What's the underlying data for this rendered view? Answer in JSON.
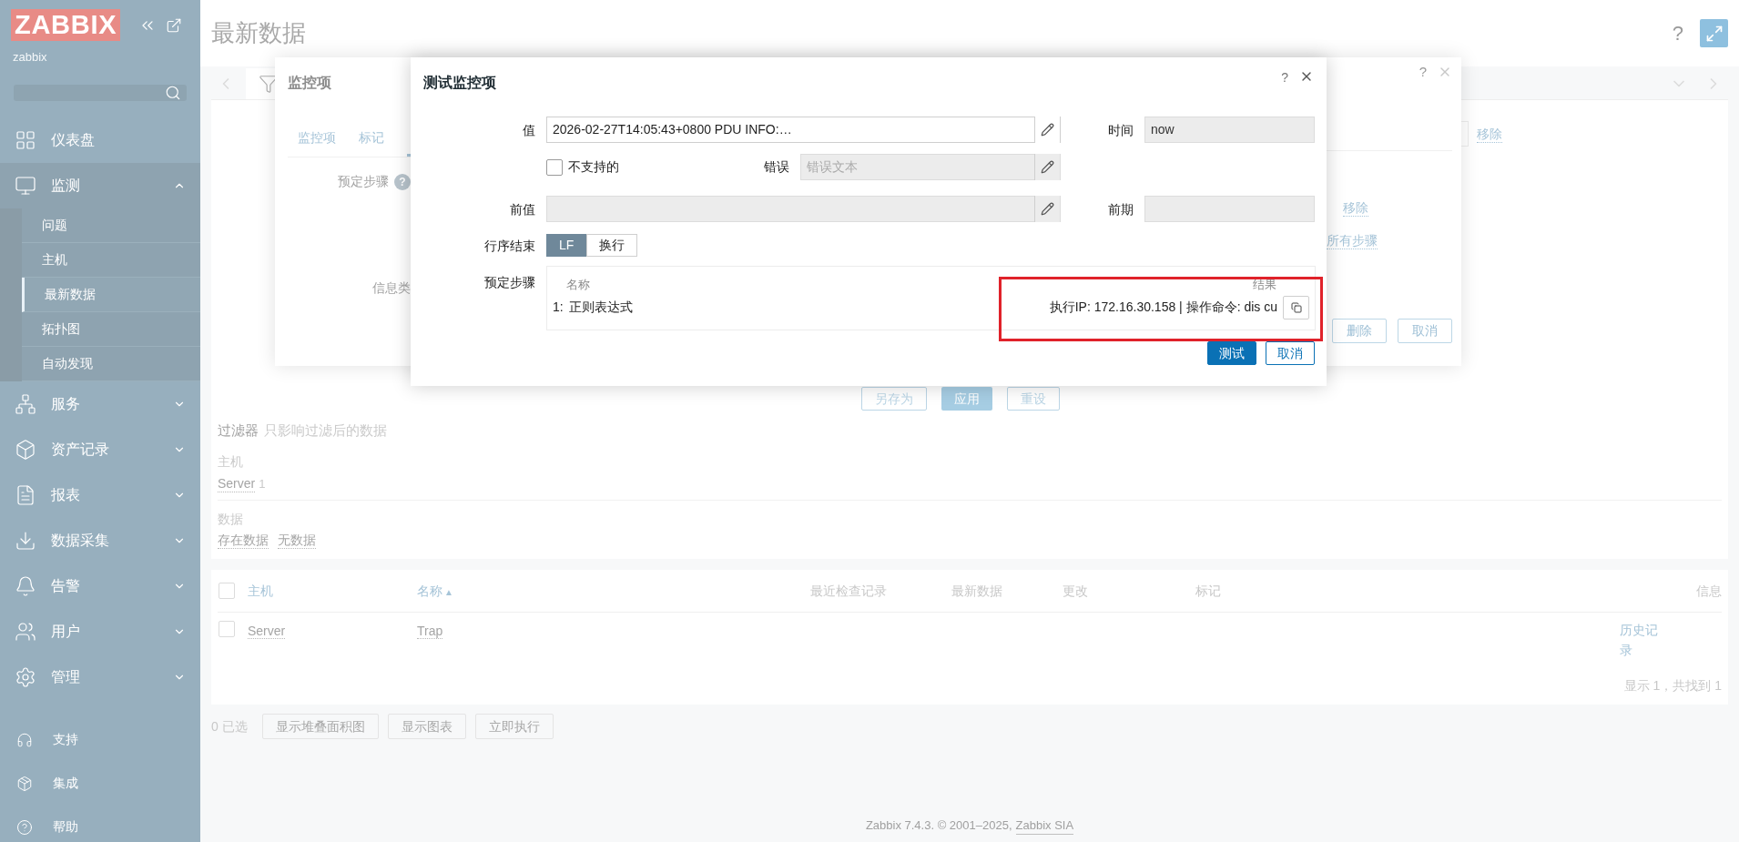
{
  "sidebar": {
    "logo": "ZABBIX",
    "user": "zabbix",
    "menu": [
      {
        "label": "仪表盘",
        "kind": "link"
      },
      {
        "label": "监测",
        "kind": "group",
        "expanded": true,
        "children": [
          {
            "label": "问题",
            "selected": false
          },
          {
            "label": "主机",
            "selected": false
          },
          {
            "label": "最新数据",
            "selected": true
          },
          {
            "label": "拓扑图",
            "selected": false
          },
          {
            "label": "自动发现",
            "selected": false
          }
        ]
      },
      {
        "label": "服务",
        "kind": "group",
        "expanded": false
      },
      {
        "label": "资产记录",
        "kind": "group",
        "expanded": false
      },
      {
        "label": "报表",
        "kind": "group",
        "expanded": false
      },
      {
        "label": "数据采集",
        "kind": "group",
        "expanded": false
      },
      {
        "label": "告警",
        "kind": "group",
        "expanded": false
      },
      {
        "label": "用户",
        "kind": "group",
        "expanded": false
      },
      {
        "label": "管理",
        "kind": "group",
        "expanded": false
      }
    ],
    "footer_links": [
      "支持",
      "集成",
      "帮助"
    ]
  },
  "header": {
    "title": "最新数据",
    "help": "?"
  },
  "filter": {
    "remove_link": "移除",
    "buttons": [
      {
        "label": "另存为",
        "kind": "secondary"
      },
      {
        "label": "应用",
        "kind": "primary"
      },
      {
        "label": "重设",
        "kind": "secondary"
      }
    ],
    "summary_title": "过滤器",
    "summary_note": "只影响过滤后的数据",
    "groups": [
      {
        "label": "主机",
        "values": [
          {
            "text": "Server",
            "count": "1"
          }
        ]
      },
      {
        "label": "数据",
        "values": [
          {
            "text": "存在数据"
          },
          {
            "text": "无数据"
          }
        ]
      }
    ]
  },
  "table": {
    "header_checked": false,
    "columns": [
      {
        "label": "主机",
        "kind": "link"
      },
      {
        "label": "名称",
        "kind": "sorted",
        "sort": "▲"
      },
      {
        "label": "最近检查记录",
        "kind": "plain"
      },
      {
        "label": "最新数据",
        "kind": "plain"
      },
      {
        "label": "更改",
        "kind": "plain"
      },
      {
        "label": "标记",
        "kind": "plain"
      },
      {
        "label": "信息",
        "kind": "plain"
      }
    ],
    "rows": [
      {
        "checked": false,
        "host": "Server",
        "name": "Trap",
        "info": "历史记录"
      }
    ],
    "summary": "显示 1，共找到 1"
  },
  "actions": {
    "selected_count": "0 已选",
    "buttons": [
      "显示堆叠面积图",
      "显示图表",
      "立即执行"
    ]
  },
  "footer": {
    "text": "Zabbix 7.4.3. © 2001–2025,",
    "link": "Zabbix SIA"
  },
  "item_dialog": {
    "title": "监控项",
    "help": "?",
    "tabs": [
      {
        "label": "监控项",
        "selected": false
      },
      {
        "label": "标记",
        "selected": false
      }
    ],
    "step_label": "预定步骤",
    "step_help": "?",
    "type_label": "信息类",
    "remove_link": "移除",
    "test_all_link": "所有步骤",
    "buttons": [
      {
        "label": "删除"
      },
      {
        "label": "取消"
      }
    ]
  },
  "test_dialog": {
    "title": "测试监控项",
    "help": "?",
    "value": {
      "label": "值",
      "value": "2026-02-27T14:05:43+0800 PDU INFO:…"
    },
    "time": {
      "label": "时间",
      "value": "now"
    },
    "not_supported": {
      "label": "不支持的",
      "checked": false
    },
    "error": {
      "label": "错误",
      "placeholder": "错误文本"
    },
    "prev_value": {
      "label": "前值"
    },
    "prev_time": {
      "label": "前期"
    },
    "eol": {
      "label": "行序结束",
      "options": [
        {
          "label": "LF",
          "selected": true
        },
        {
          "label": "换行",
          "selected": false
        }
      ]
    },
    "steps": {
      "label": "预定步骤",
      "columns": [
        "名称",
        "结果"
      ],
      "rows": [
        {
          "index": "1:",
          "name": "正则表达式",
          "result": "执行IP: 172.16.30.158 | 操作命令: dis cu"
        }
      ]
    },
    "buttons": [
      {
        "label": "测试",
        "kind": "primary"
      },
      {
        "label": "取消",
        "kind": "secondary"
      }
    ]
  }
}
